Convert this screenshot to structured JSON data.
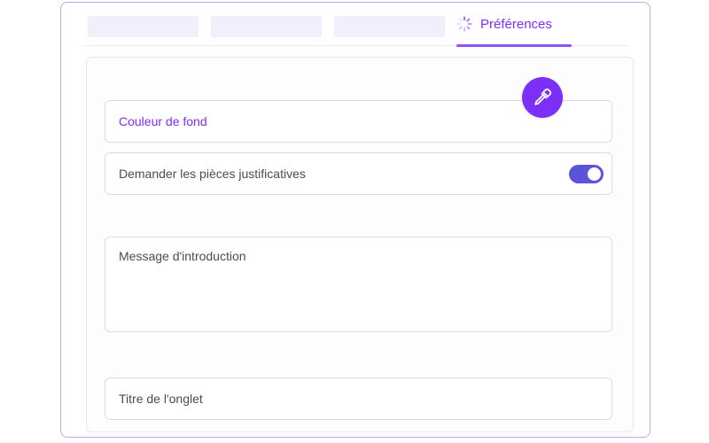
{
  "tabs": {
    "placeholder_count": 3,
    "active_label": "Préférences"
  },
  "form": {
    "background_color_label": "Couleur de fond",
    "request_documents_label": "Demander les pièces justificatives",
    "request_documents_enabled": true,
    "intro_message_placeholder": "Message d'introduction",
    "tab_title_placeholder": "Titre de l'onglet"
  },
  "colors": {
    "accent": "#7b2ff7",
    "toggle_on": "#5a55d8",
    "border": "#b9a9f3"
  },
  "icons": {
    "active_tab": "spinner-icon",
    "picker": "eyedropper-icon"
  }
}
